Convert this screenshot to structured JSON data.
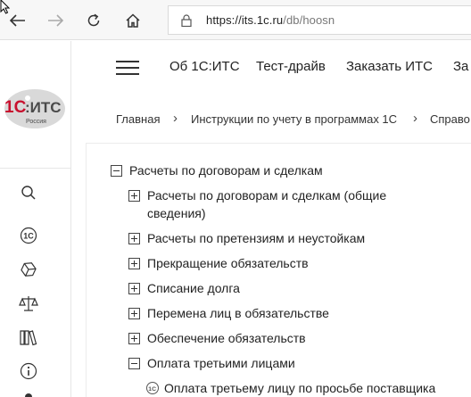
{
  "browser": {
    "url_host": "https://its.1c.ru",
    "url_path": "/db/hoosn"
  },
  "logo": {
    "brand": "1С:ИТС",
    "sub": "Россия"
  },
  "rail": {
    "icons": [
      "search-icon",
      "1c-icon",
      "cube-icon",
      "scales-icon",
      "books-icon",
      "info-icon"
    ]
  },
  "menu": {
    "items": [
      "Об 1С:ИТС",
      "Тест-драйв",
      "Заказать ИТС",
      "За"
    ]
  },
  "breadcrumbs": [
    "Главная",
    "Инструкции по учету в программах 1С",
    "Справо"
  ],
  "tree": {
    "root": "Расчеты по договорам и сделкам",
    "children": [
      {
        "label_line1": "Расчеты по договорам и сделкам (общие",
        "label_line2": "сведения)",
        "state": "collapsed"
      },
      {
        "label_line1": "Расчеты по претензиям и неустойкам",
        "state": "collapsed"
      },
      {
        "label_line1": "Прекращение обязательств",
        "state": "collapsed"
      },
      {
        "label_line1": "Списание долга",
        "state": "collapsed"
      },
      {
        "label_line1": "Перемена лиц в обязательстве",
        "state": "collapsed"
      },
      {
        "label_line1": "Обеспечение обязательств",
        "state": "collapsed"
      },
      {
        "label_line1": "Оплата третьими лицами",
        "state": "expanded"
      }
    ],
    "leaf": "Оплата третьему лицу по просьбе поставщика"
  }
}
